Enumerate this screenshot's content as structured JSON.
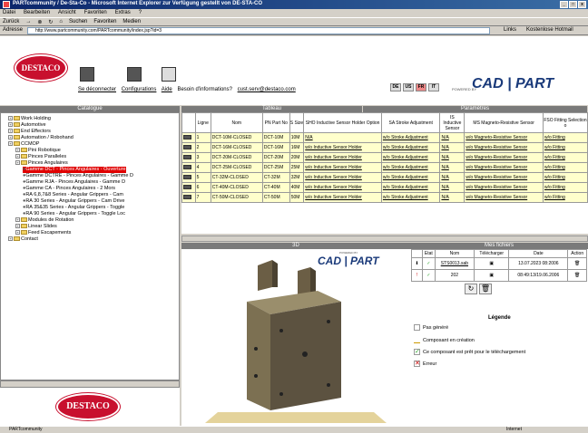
{
  "window": {
    "title": "PARTcommunity / De-Sta-Co - Microsoft Internet Explorer zur Verfügung gestellt von DE-STA-CO"
  },
  "menu": [
    "Datei",
    "Bearbeiten",
    "Ansicht",
    "Favoriten",
    "Extras",
    "?"
  ],
  "toolbar": [
    "Zurück",
    "Suchen",
    "Favoriten",
    "Medien"
  ],
  "address": {
    "label": "Adresse",
    "url": "http://www.partcommunity.com/PARTcommunity/index.jsp?id=3",
    "go": "Links",
    "links": "Kostenlose Hotmail"
  },
  "header": {
    "links": [
      "Se déconnecter",
      "Configurations",
      "Aide",
      "Besoin d'informations?",
      "cust.serv@destaco.com"
    ],
    "flags": [
      "DE",
      "US",
      "FR",
      "IT"
    ],
    "brand": "CAD | PART",
    "powered": "POWERED BY"
  },
  "left": {
    "title": "Catalogue",
    "tree": [
      {
        "label": "Work Holding",
        "lvl": 0
      },
      {
        "label": "Automotive",
        "lvl": 0
      },
      {
        "label": "End Effectors",
        "lvl": 0
      },
      {
        "label": "Automation / Robohand",
        "lvl": 0
      },
      {
        "label": "CCMOP",
        "lvl": 0
      },
      {
        "label": "Pini Robotique",
        "lvl": 1
      },
      {
        "label": "Pinces Paralleles",
        "lvl": 1
      },
      {
        "label": "Pinces Angulaires",
        "lvl": 1
      },
      {
        "label": "Gamme DCT - Pinces Angulaires - Ouverture",
        "lvl": 2,
        "sel": true
      },
      {
        "label": "Gamme DCTRE - Pinces Angulaires - Gamme D",
        "lvl": 2
      },
      {
        "label": "Gamme RJA - Pinces Angulaires - Gamme D",
        "lvl": 2
      },
      {
        "label": "Gamme CA - Pinces Angulaires - 2 Mors",
        "lvl": 2
      },
      {
        "label": "RA 6,8,7&8 Series - Angular Grippers - Cam",
        "lvl": 2
      },
      {
        "label": "RA 30 Series - Angular Grippers - Cam Drive",
        "lvl": 2
      },
      {
        "label": "RA 35&35 Series - Angular Grippers - Toggle",
        "lvl": 2
      },
      {
        "label": "RA 90 Series - Angular Grippers - Toggle Loc",
        "lvl": 2
      },
      {
        "label": "Modules de Rotation",
        "lvl": 1
      },
      {
        "label": "Linear Slides",
        "lvl": 1
      },
      {
        "label": "Feed Escapements",
        "lvl": 1
      },
      {
        "label": "Contact",
        "lvl": 0
      }
    ]
  },
  "table": {
    "title": "Tableau",
    "params_title": "Paramètres",
    "headers": [
      "Ligne",
      "Nom",
      "PN Part No",
      "S Size",
      "SHO Inductive Sensor Holder Option",
      "SA Stroke Adjustment",
      "IS Inductive Sensor",
      "MS Magneto-Resistive Sensor",
      "FSO Fitting Selection o"
    ],
    "rows": [
      [
        "1",
        "DCT-10M-CLOSED",
        "DCT-10M",
        "10M",
        "N/A",
        "w/o Stroke Adjustment",
        "N/A",
        "w/o Magneto-Resistive Sensor",
        "w/o Fitting"
      ],
      [
        "2",
        "DCT-16M-CLOSED",
        "DCT-16M",
        "16M",
        "w/o Inductive Sensor Holder",
        "w/o Stroke Adjustment",
        "N/A",
        "w/o Magneto-Resistive Sensor",
        "w/o Fitting"
      ],
      [
        "3",
        "DCT-20M-CLOSED",
        "DCT-20M",
        "20M",
        "w/o Inductive Sensor Holder",
        "w/o Stroke Adjustment",
        "N/A",
        "w/o Magneto-Resistive Sensor",
        "w/o Fitting"
      ],
      [
        "4",
        "DCT-25M-CLOSED",
        "DCT-25M",
        "25M",
        "w/o Inductive Sensor Holder",
        "w/o Stroke Adjustment",
        "N/A",
        "w/o Magneto-Resistive Sensor",
        "w/o Fitting"
      ],
      [
        "5",
        "CT-32M-CLOSED",
        "CT-32M",
        "32M",
        "w/o Inductive Sensor Holder",
        "w/o Stroke Adjustment",
        "N/A",
        "w/o Magneto-Resistive Sensor",
        "w/o Fitting"
      ],
      [
        "6",
        "CT-40M-CLOSED",
        "CT-40M",
        "40M",
        "w/o Inductive Sensor Holder",
        "w/o Stroke Adjustment",
        "N/A",
        "w/o Magneto-Resistive Sensor",
        "w/o Fitting"
      ],
      [
        "7",
        "CT-50M-CLOSED",
        "CT-50M",
        "50M",
        "w/o Inductive Sensor Holder",
        "w/o Stroke Adjustment",
        "N/A",
        "w/o Magneto-Resistive Sensor",
        "w/o Fitting"
      ]
    ]
  },
  "view3d": {
    "title": "3D"
  },
  "files": {
    "title": "Mes fichiers",
    "headers": [
      "Etat",
      "Nom",
      "Télécharger",
      "Date",
      "Action"
    ],
    "rows": [
      {
        "name": "STS0013.sab",
        "date": "13.07.2023 08:2006"
      },
      {
        "name": "202",
        "date": "08:49:13/19.06.2006"
      }
    ],
    "legend_title": "Légende",
    "legend": [
      "Pas généré",
      "Composant en création",
      "Ce composant est prêt pour le téléchargement",
      "Erreur"
    ]
  },
  "status": {
    "left": "PARTcommunity",
    "right": "Internet"
  },
  "colors": {
    "accent": "#c8102e",
    "header": "#7a7a7a",
    "rowYellow": "#ffffcc"
  }
}
